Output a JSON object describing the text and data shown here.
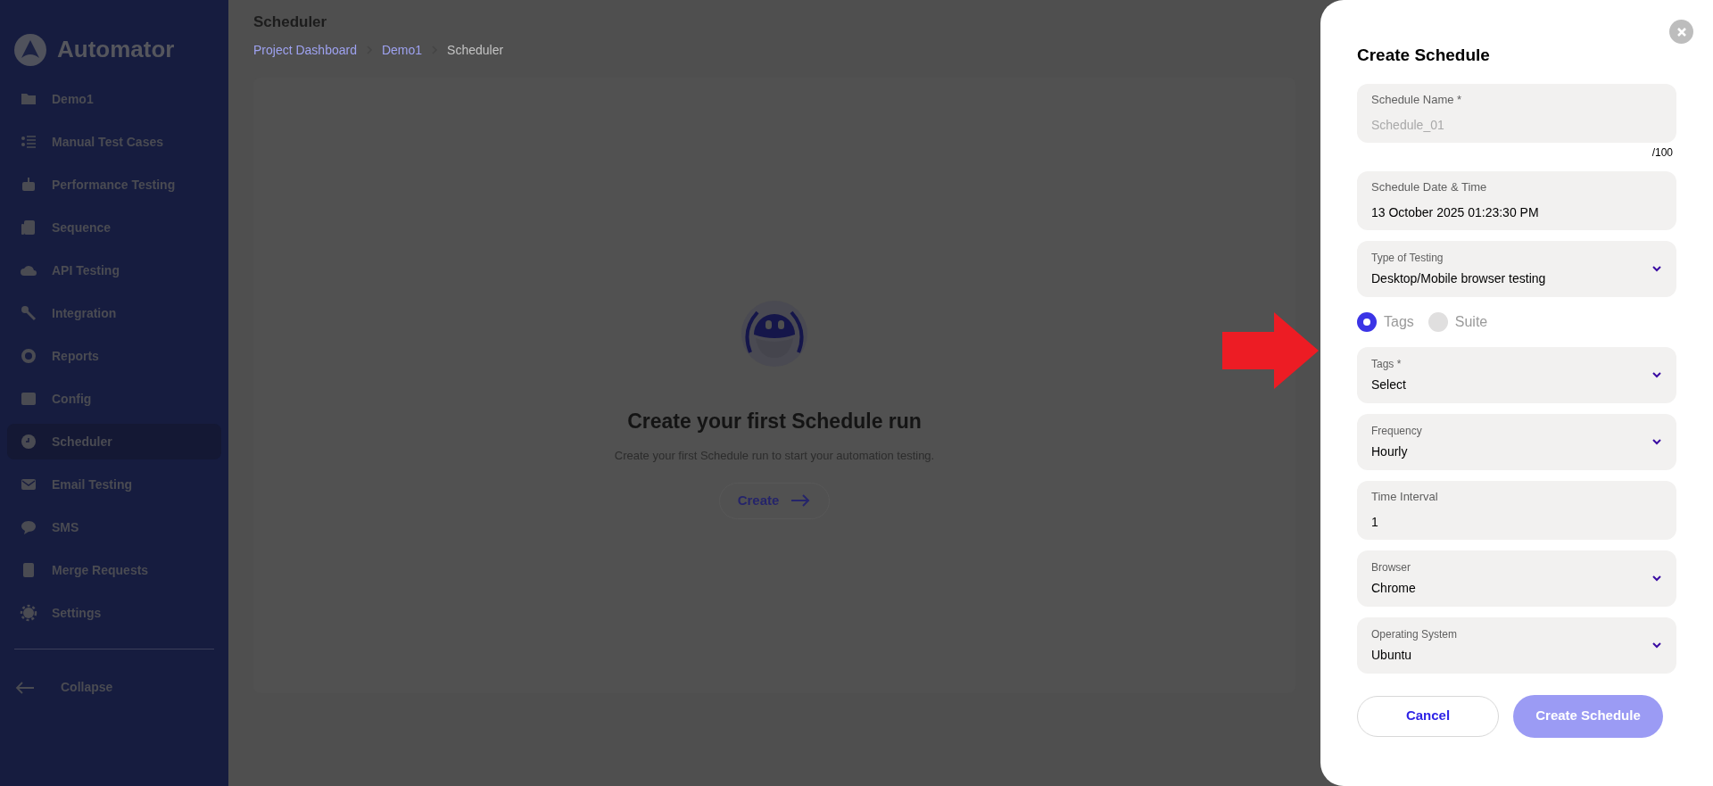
{
  "sidebar": {
    "brand": "Automator",
    "items": [
      {
        "label": "Demo1",
        "selected": false
      },
      {
        "label": "Manual Test Cases",
        "selected": false
      },
      {
        "label": "Performance Testing",
        "selected": false
      },
      {
        "label": "Sequence",
        "selected": false
      },
      {
        "label": "API Testing",
        "selected": false
      },
      {
        "label": "Integration",
        "selected": false
      },
      {
        "label": "Reports",
        "selected": false
      },
      {
        "label": "Config",
        "selected": false
      },
      {
        "label": "Scheduler",
        "selected": true
      },
      {
        "label": "Email Testing",
        "selected": false
      },
      {
        "label": "SMS",
        "selected": false
      },
      {
        "label": "Merge Requests",
        "selected": false
      },
      {
        "label": "Settings",
        "selected": false
      }
    ],
    "collapse": "Collapse"
  },
  "page": {
    "title": "Scheduler",
    "breadcrumb": [
      {
        "label": "Project Dashboard",
        "kind": "link"
      },
      {
        "label": "Demo1",
        "kind": "link"
      },
      {
        "label": "Scheduler",
        "kind": "current"
      }
    ]
  },
  "empty_state": {
    "title": "Create your first Schedule run",
    "subtitle": "Create your first Schedule run to start your automation testing.",
    "button": "Create"
  },
  "dialog": {
    "title": "Create Schedule",
    "fields": [
      {
        "kind": "text",
        "label": "Schedule Name *",
        "placeholder": "Schedule_01",
        "counter": "/100"
      },
      {
        "kind": "text",
        "label": "Schedule Date & Time",
        "value": "13 October 2025 01:23:30 PM"
      },
      {
        "kind": "select",
        "label": "Type of Testing",
        "value": "Desktop/Mobile browser testing"
      },
      {
        "kind": "radio",
        "options": [
          {
            "label": "Tags",
            "selected": true
          },
          {
            "label": "Suite",
            "selected": false
          }
        ]
      },
      {
        "kind": "select",
        "label": "Tags *",
        "value": "Select"
      },
      {
        "kind": "select",
        "label": "Frequency",
        "value": "Hourly"
      },
      {
        "kind": "text",
        "label": "Time Interval",
        "value": "1"
      },
      {
        "kind": "select",
        "label": "Browser",
        "value": "Chrome"
      },
      {
        "kind": "select",
        "label": "Operating System",
        "value": "Ubuntu"
      }
    ],
    "buttons": [
      {
        "label": "Cancel",
        "kind": "secondary"
      },
      {
        "label": "Create Schedule",
        "kind": "primary"
      }
    ]
  }
}
